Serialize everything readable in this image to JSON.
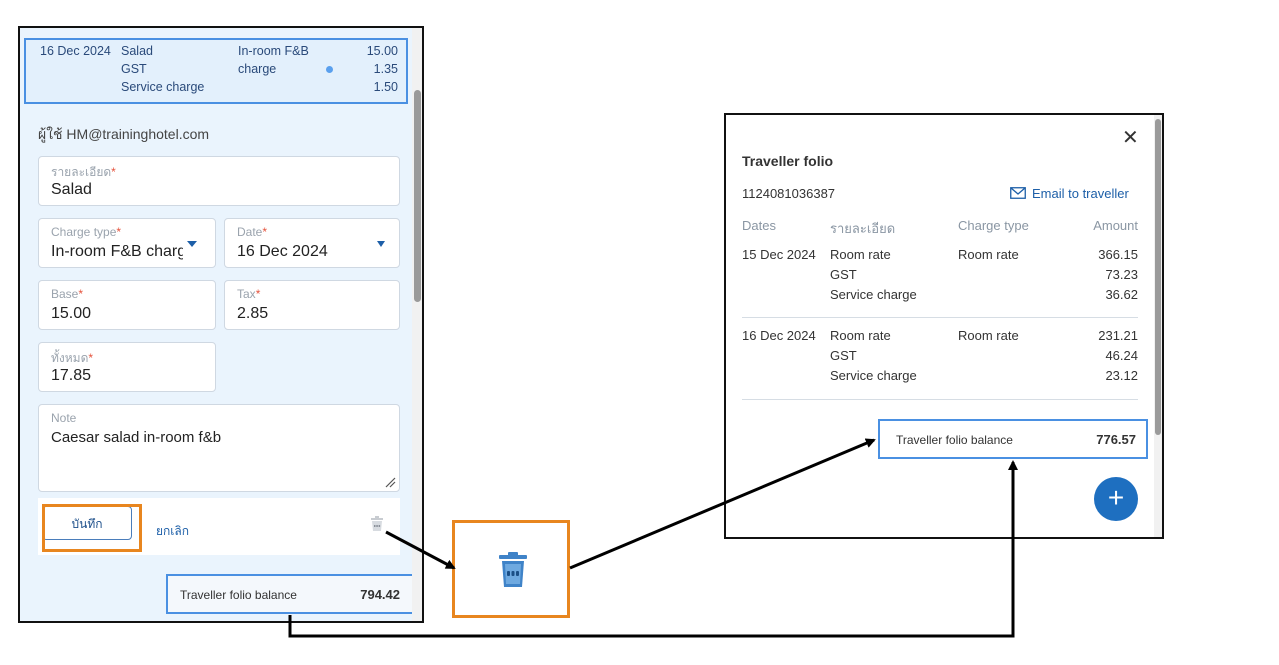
{
  "left_panel": {
    "charge_row": {
      "date": "16 Dec 2024",
      "items": [
        "Salad",
        "GST",
        "Service charge"
      ],
      "type_line1": "In-room F&B",
      "type_line2": "charge",
      "amounts": [
        "15.00",
        "1.35",
        "1.50"
      ]
    },
    "user_line": "ผู้ใช้ HM@traininghotel.com",
    "form": {
      "details_label": "รายละเอียด",
      "details_value": "Salad",
      "charge_type_label": "Charge type",
      "charge_type_value": "In-room F&B charge",
      "date_label": "Date",
      "date_value": "16 Dec 2024",
      "base_label": "Base",
      "base_value": "15.00",
      "tax_label": "Tax",
      "tax_value": "2.85",
      "total_label": "ทั้งหมด",
      "total_value": "17.85",
      "note_label": "Note",
      "note_value": "Caesar salad in-room f&b",
      "required_mark": "*"
    },
    "save_label": "บันทึก",
    "cancel_label": "ยกเลิก",
    "balance_label": "Traveller folio balance",
    "balance_value": "794.42"
  },
  "right_panel": {
    "title": "Traveller folio",
    "folio_number": "1124081036387",
    "email_label": "Email to traveller",
    "headers": {
      "dates": "Dates",
      "details": "รายละเอียด",
      "charge_type": "Charge type",
      "amount": "Amount"
    },
    "groups": [
      {
        "date": "15 Dec 2024",
        "charge_type": "Room rate",
        "items": [
          "Room rate",
          "GST",
          "Service charge"
        ],
        "amounts": [
          "366.15",
          "73.23",
          "36.62"
        ]
      },
      {
        "date": "16 Dec 2024",
        "charge_type": "Room rate",
        "items": [
          "Room rate",
          "GST",
          "Service charge"
        ],
        "amounts": [
          "231.21",
          "46.24",
          "23.12"
        ]
      }
    ],
    "balance_label": "Traveller folio balance",
    "balance_value": "776.57",
    "add_symbol": "+",
    "close_symbol": "✕"
  },
  "colors": {
    "accent": "#1e6fc0",
    "highlight": "#e8861f",
    "selection_border": "#4a90e2"
  }
}
